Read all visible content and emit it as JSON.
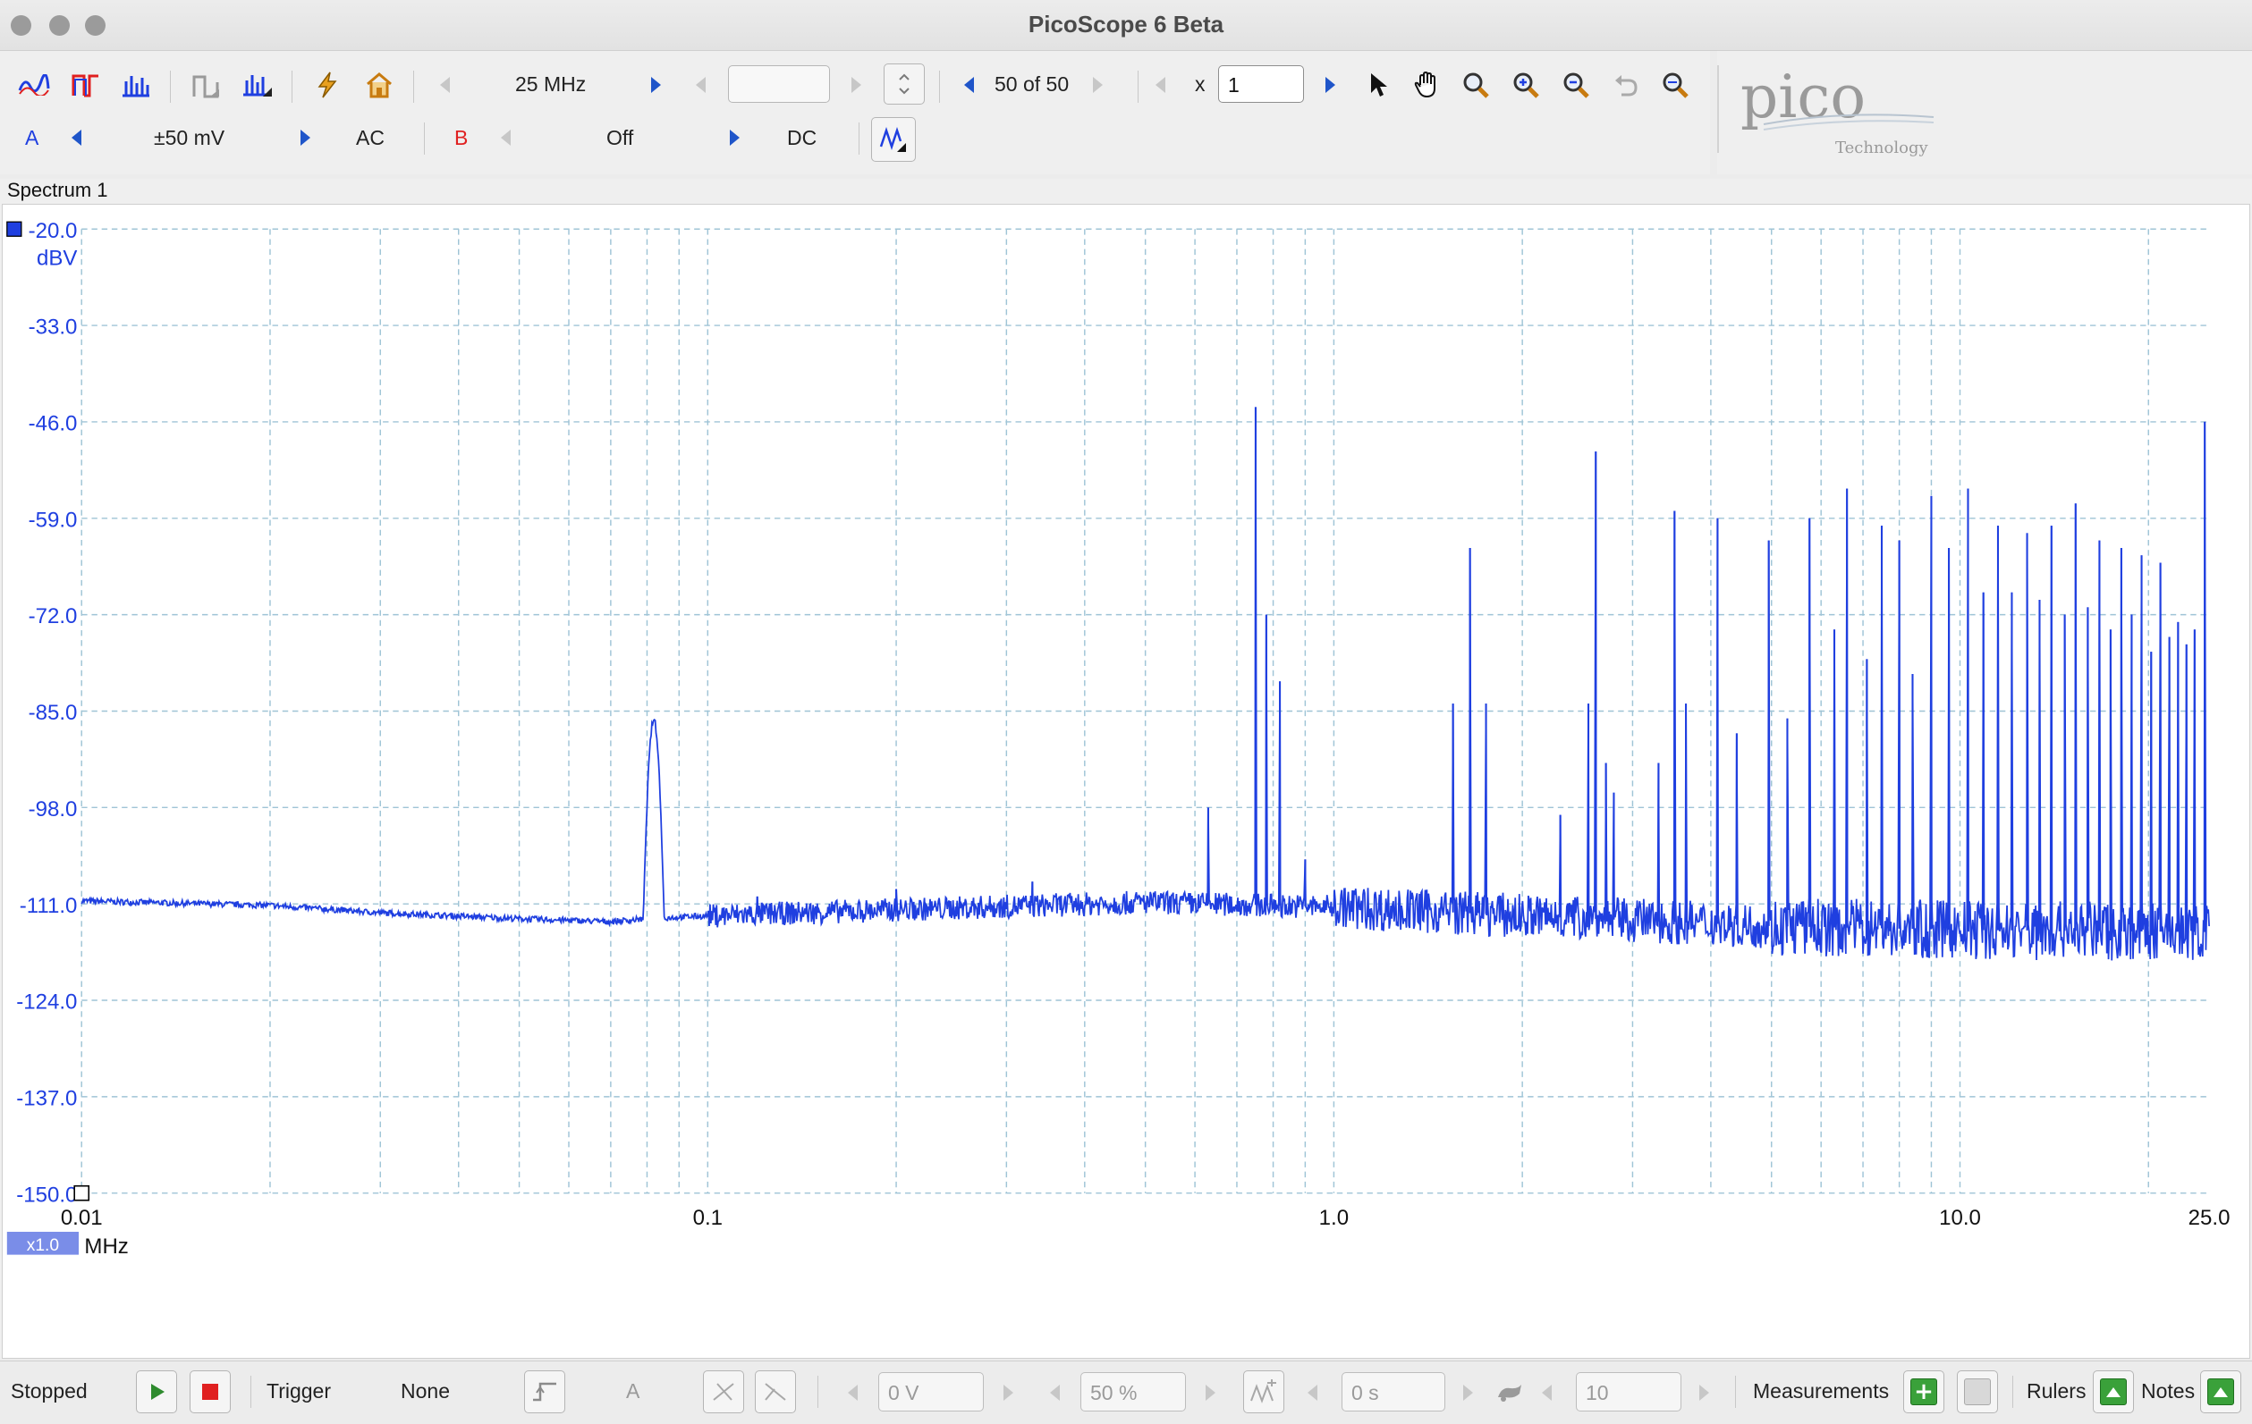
{
  "window": {
    "title": "PicoScope 6 Beta"
  },
  "toolbar": {
    "bandwidth": "25 MHz",
    "capture_count": "50 of 50",
    "zoom_prefix": "x",
    "zoom_value": "1",
    "scope_icons": [
      "scope-mode-icon",
      "persistence-mode-icon",
      "spectrum-mode-icon",
      "spectrum-view-icon",
      "spectrum-options-icon",
      "signal-generator-icon",
      "home-icon"
    ],
    "tool_icons": [
      "pointer-icon",
      "hand-icon",
      "zoom-icon",
      "zoom-in-icon",
      "zoom-out-icon",
      "undo-zoom-icon",
      "zoom-fit-icon"
    ]
  },
  "channels": {
    "a": {
      "label": "A",
      "range": "±50 mV",
      "coupling": "AC",
      "color": "#1f3fe0"
    },
    "b": {
      "label": "B",
      "range": "Off",
      "coupling": "DC",
      "color": "#e02020"
    }
  },
  "logo": {
    "name": "pico",
    "sub": "Technology"
  },
  "view": {
    "tab": "Spectrum 1",
    "y_unit": "dBV",
    "x_unit": "MHz",
    "zoom_badge": "x1.0"
  },
  "chart_data": {
    "type": "line",
    "x_scale": "log",
    "xlim": [
      0.01,
      25.0
    ],
    "ylim": [
      -150.0,
      -20.0
    ],
    "grid": true,
    "x_ticks": [
      "0.01",
      "0.1",
      "1.0",
      "10.0",
      "25.0"
    ],
    "y_ticks": [
      "-20.0",
      "-33.0",
      "-46.0",
      "-59.0",
      "-72.0",
      "-85.0",
      "-98.0",
      "-111.0",
      "-124.0",
      "-137.0",
      "-150.0"
    ],
    "ylabel": "dBV",
    "xlabel": "MHz",
    "series": [
      {
        "color": "#1f3fe0",
        "noise_floor": [
          [
            0.01,
            -110.6
          ],
          [
            0.02,
            -111.2
          ],
          [
            0.03,
            -112.2
          ],
          [
            0.05,
            -113.0
          ],
          [
            0.07,
            -113.4
          ],
          [
            0.08,
            -113.0
          ],
          [
            0.1,
            -112.6
          ],
          [
            0.2,
            -111.8
          ],
          [
            0.5,
            -110.8
          ],
          [
            1.0,
            -111.4
          ],
          [
            2.0,
            -112.6
          ],
          [
            5.0,
            -114.0
          ],
          [
            10.0,
            -114.5
          ],
          [
            25.0,
            -114.8
          ]
        ],
        "broad_peak": {
          "x": 0.082,
          "y": -86.2
        },
        "peaks": [
          {
            "x": 0.12,
            "y": -110.0
          },
          {
            "x": 0.2,
            "y": -109.0
          },
          {
            "x": 0.33,
            "y": -108.0
          },
          {
            "x": 0.63,
            "y": -98.0
          },
          {
            "x": 0.75,
            "y": -44.0
          },
          {
            "x": 0.78,
            "y": -72.0
          },
          {
            "x": 0.82,
            "y": -81.0
          },
          {
            "x": 0.9,
            "y": -105.0
          },
          {
            "x": 1.55,
            "y": -84.0
          },
          {
            "x": 1.65,
            "y": -63.0
          },
          {
            "x": 1.75,
            "y": -84.0
          },
          {
            "x": 2.3,
            "y": -99.0
          },
          {
            "x": 2.55,
            "y": -84.0
          },
          {
            "x": 2.62,
            "y": -50.0
          },
          {
            "x": 2.72,
            "y": -92.0
          },
          {
            "x": 2.8,
            "y": -96.0
          },
          {
            "x": 3.3,
            "y": -92.0
          },
          {
            "x": 3.5,
            "y": -58.0
          },
          {
            "x": 3.65,
            "y": -84.0
          },
          {
            "x": 4.1,
            "y": -59.0
          },
          {
            "x": 4.4,
            "y": -88.0
          },
          {
            "x": 4.95,
            "y": -62.0
          },
          {
            "x": 5.3,
            "y": -86.0
          },
          {
            "x": 5.75,
            "y": -59.0
          },
          {
            "x": 6.3,
            "y": -74.0
          },
          {
            "x": 6.6,
            "y": -55.0
          },
          {
            "x": 7.1,
            "y": -78.0
          },
          {
            "x": 7.5,
            "y": -60.0
          },
          {
            "x": 8.0,
            "y": -62.0
          },
          {
            "x": 8.4,
            "y": -80.0
          },
          {
            "x": 9.0,
            "y": -56.0
          },
          {
            "x": 9.6,
            "y": -63.0
          },
          {
            "x": 10.3,
            "y": -55.0
          },
          {
            "x": 10.9,
            "y": -69.0
          },
          {
            "x": 11.5,
            "y": -60.0
          },
          {
            "x": 12.1,
            "y": -69.0
          },
          {
            "x": 12.8,
            "y": -61.0
          },
          {
            "x": 13.4,
            "y": -70.0
          },
          {
            "x": 14.0,
            "y": -60.0
          },
          {
            "x": 14.7,
            "y": -72.0
          },
          {
            "x": 15.3,
            "y": -57.0
          },
          {
            "x": 16.0,
            "y": -71.0
          },
          {
            "x": 16.7,
            "y": -62.0
          },
          {
            "x": 17.4,
            "y": -74.0
          },
          {
            "x": 18.1,
            "y": -63.0
          },
          {
            "x": 18.8,
            "y": -72.0
          },
          {
            "x": 19.5,
            "y": -64.0
          },
          {
            "x": 20.2,
            "y": -77.0
          },
          {
            "x": 20.9,
            "y": -65.0
          },
          {
            "x": 21.6,
            "y": -75.0
          },
          {
            "x": 22.3,
            "y": -73.0
          },
          {
            "x": 23.0,
            "y": -76.0
          },
          {
            "x": 23.7,
            "y": -74.0
          },
          {
            "x": 24.6,
            "y": -46.0
          }
        ]
      }
    ]
  },
  "status": {
    "state": "Stopped",
    "trigger_label": "Trigger",
    "trigger_mode": "None",
    "trigger_channel": "A",
    "threshold": "0 V",
    "position": "50 %",
    "delay": "0 s",
    "rearm": "10",
    "measurements": "Measurements",
    "rulers": "Rulers",
    "notes": "Notes"
  }
}
